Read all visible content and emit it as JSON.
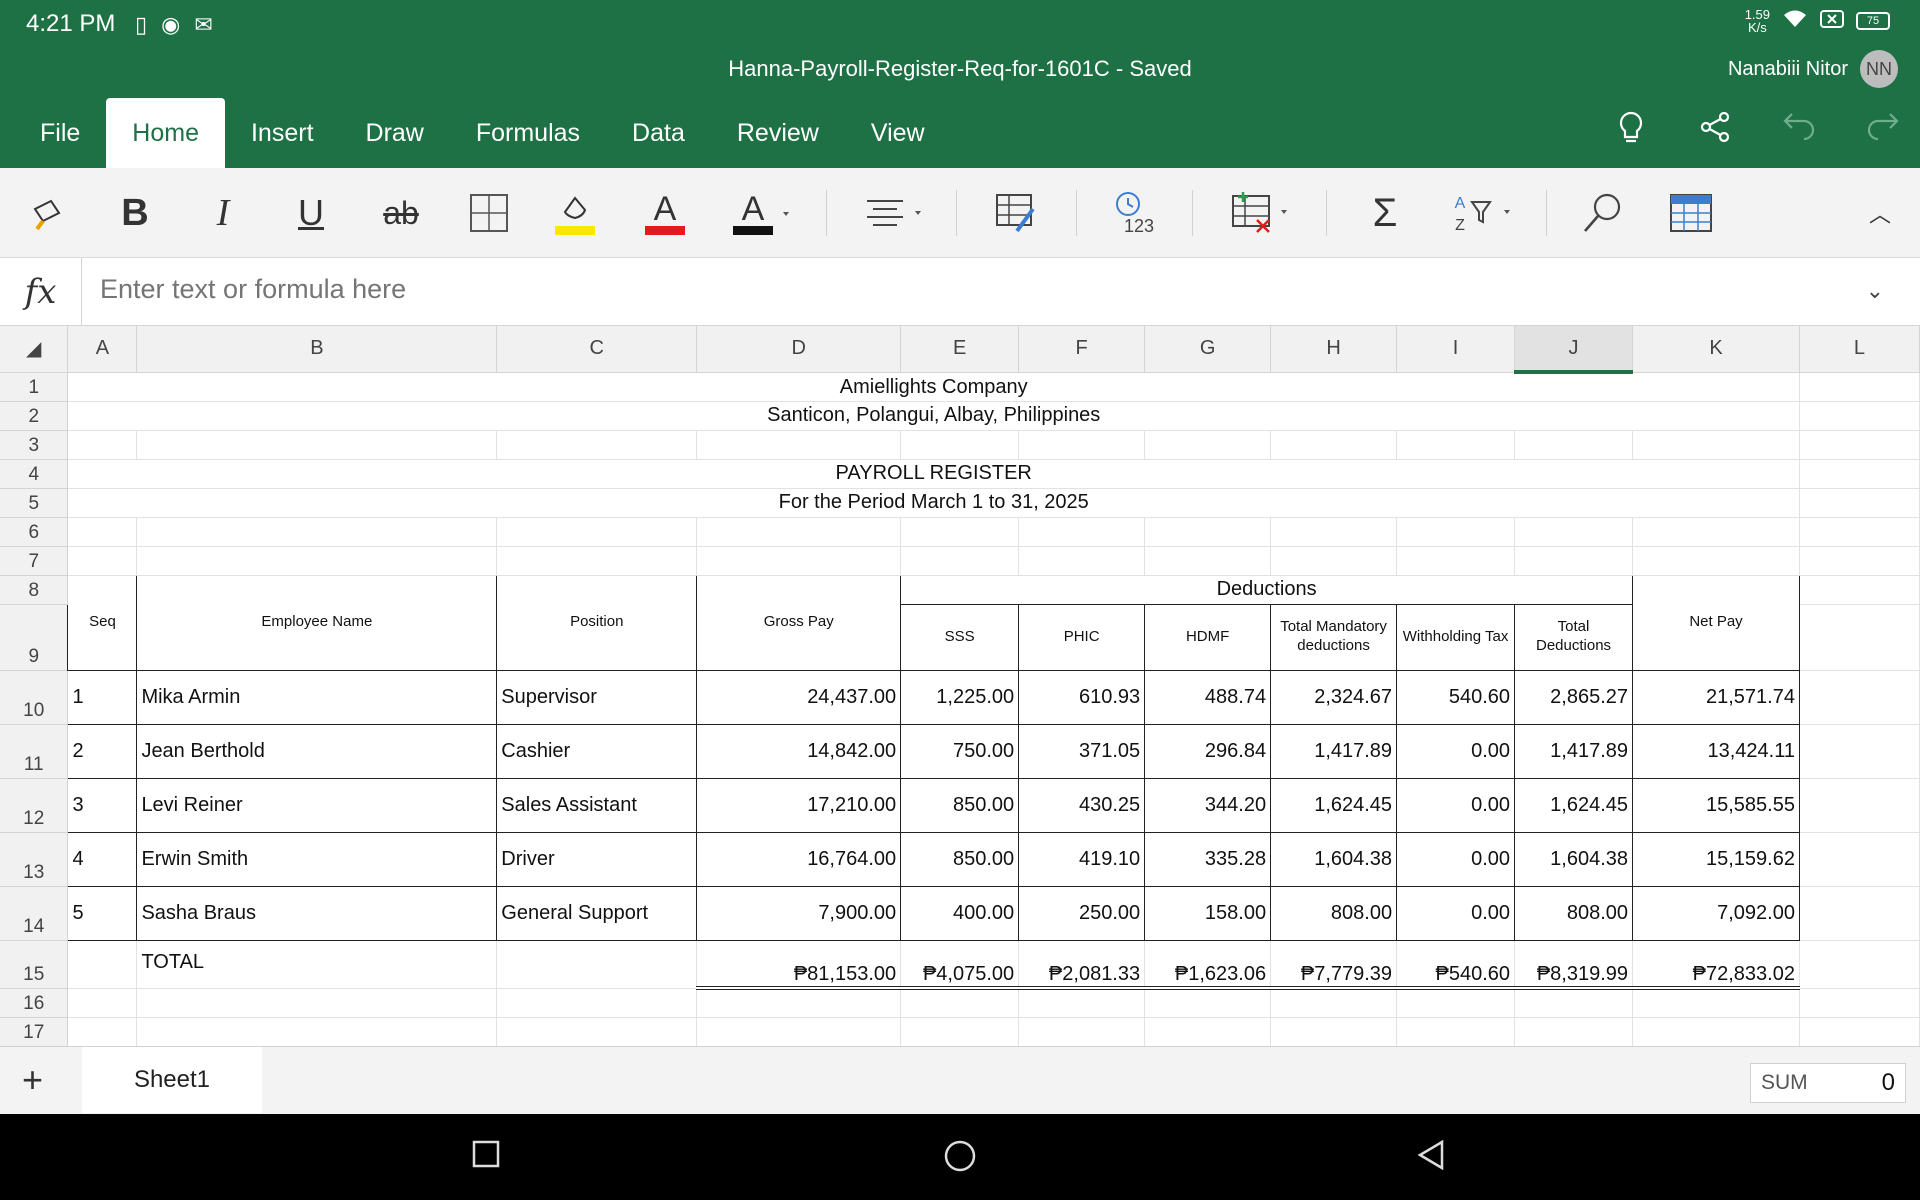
{
  "status_bar": {
    "time": "4:21 PM",
    "net_speed": "1.59",
    "net_unit": "K/s",
    "battery": "75"
  },
  "document": {
    "title": "Hanna-Payroll-Register-Req-for-1601C - Saved"
  },
  "user": {
    "name": "Nanabiii Nitor",
    "initials": "NN"
  },
  "ribbon_tabs": [
    "File",
    "Home",
    "Insert",
    "Draw",
    "Formulas",
    "Data",
    "Review",
    "View"
  ],
  "active_tab": "Home",
  "formula_bar": {
    "placeholder": "Enter text or formula here",
    "fx": "fx"
  },
  "column_headers": [
    "A",
    "B",
    "C",
    "D",
    "E",
    "F",
    "G",
    "H",
    "I",
    "J",
    "K",
    "L"
  ],
  "selected_column": "J",
  "sheet": {
    "company": "Amiellights Company",
    "address": "Santicon, Polangui, Albay, Philippines",
    "report_title": "PAYROLL REGISTER",
    "period": "For the Period March 1 to 31, 2025",
    "headers": {
      "seq": "Seq",
      "employee_name": "Employee Name",
      "position": "Position",
      "gross_pay": "Gross Pay",
      "deductions": "Deductions",
      "sss": "SSS",
      "phic": "PHIC",
      "hdmf": "HDMF",
      "total_mandatory": "Total Mandatory deductions",
      "withholding_tax": "Withholding Tax",
      "total_deductions": "Total Deductions",
      "net_pay": "Net Pay"
    },
    "rows": [
      {
        "row": "10",
        "seq": "1",
        "name": "Mika Armin",
        "position": "Supervisor",
        "gross": "24,437.00",
        "sss": "1,225.00",
        "phic": "610.93",
        "hdmf": "488.74",
        "tmd": "2,324.67",
        "wtax": "540.60",
        "tded": "2,865.27",
        "net": "21,571.74"
      },
      {
        "row": "11",
        "seq": "2",
        "name": "Jean Berthold",
        "position": "Cashier",
        "gross": "14,842.00",
        "sss": "750.00",
        "phic": "371.05",
        "hdmf": "296.84",
        "tmd": "1,417.89",
        "wtax": "0.00",
        "tded": "1,417.89",
        "net": "13,424.11"
      },
      {
        "row": "12",
        "seq": "3",
        "name": "Levi Reiner",
        "position": "Sales Assistant",
        "gross": "17,210.00",
        "sss": "850.00",
        "phic": "430.25",
        "hdmf": "344.20",
        "tmd": "1,624.45",
        "wtax": "0.00",
        "tded": "1,624.45",
        "net": "15,585.55"
      },
      {
        "row": "13",
        "seq": "4",
        "name": "Erwin Smith",
        "position": "Driver",
        "gross": "16,764.00",
        "sss": "850.00",
        "phic": "419.10",
        "hdmf": "335.28",
        "tmd": "1,604.38",
        "wtax": "0.00",
        "tded": "1,604.38",
        "net": "15,159.62"
      },
      {
        "row": "14",
        "seq": "5",
        "name": "Sasha Braus",
        "position": "General Support",
        "gross": "7,900.00",
        "sss": "400.00",
        "phic": "250.00",
        "hdmf": "158.00",
        "tmd": "808.00",
        "wtax": "0.00",
        "tded": "808.00",
        "net": "7,092.00"
      }
    ],
    "total": {
      "label": "TOTAL",
      "gross": "₱81,153.00",
      "sss": "₱4,075.00",
      "phic": "₱2,081.33",
      "hdmf": "₱1,623.06",
      "tmd": "₱7,779.39",
      "wtax": "₱540.60",
      "tded": "₱8,319.99",
      "net": "₱72,833.02"
    }
  },
  "sheet_tab": {
    "name": "Sheet1",
    "add": "+"
  },
  "status": {
    "function": "SUM",
    "value": "0"
  }
}
